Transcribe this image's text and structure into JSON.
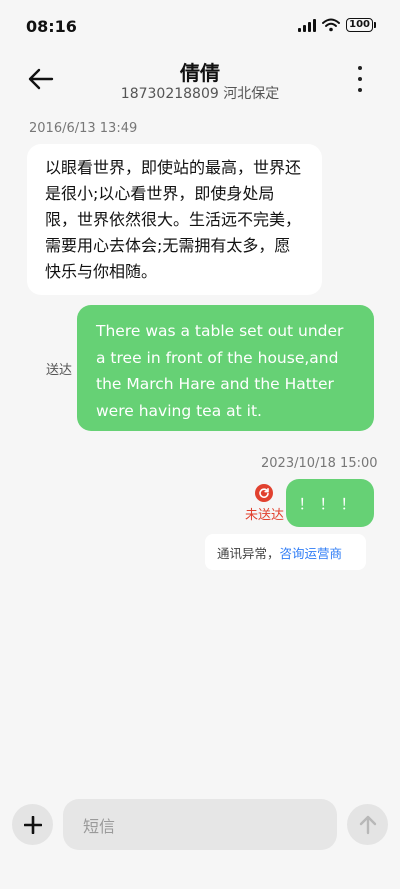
{
  "status_bar": {
    "time": "08:16",
    "battery": "100"
  },
  "header": {
    "contact_name": "倩倩",
    "contact_sub": "18730218809 河北保定"
  },
  "messages": [
    {
      "timestamp": "2016/6/13 13:49",
      "direction": "incoming",
      "text": "以眼看世界，即使站的最高，世界还是很小;以心看世界，即使身处局限，世界依然很大。生活远不完美，需要用心去体会;无需拥有太多，愿快乐与你相随。"
    },
    {
      "direction": "outgoing",
      "status": "送达",
      "text": "There was a table set out under a tree in front of the house,and the March Hare and the Hatter were having tea at it."
    },
    {
      "timestamp": "2023/10/18 15:00",
      "direction": "outgoing",
      "status": "未送达",
      "text": "！！！"
    }
  ],
  "error_notice": {
    "text": "通讯异常，",
    "link": "咨询运营商"
  },
  "composer": {
    "placeholder": "短信"
  },
  "colors": {
    "bubble_outgoing": "#66d175",
    "error_red": "#e1412f",
    "link_blue": "#2e7cf6"
  }
}
